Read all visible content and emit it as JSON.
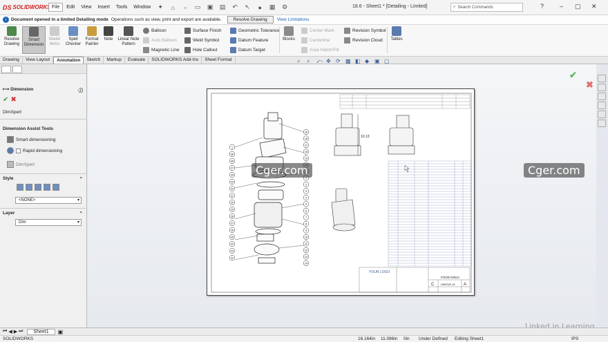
{
  "app": {
    "logo_ds": "DS",
    "logo": "SOLIDWORKS",
    "title": "18.6 - Sheet1 * [Detailing - Limited]"
  },
  "menu": [
    "File",
    "Edit",
    "View",
    "Insert",
    "Tools",
    "Window"
  ],
  "search": {
    "placeholder": "Search Commands"
  },
  "infobar": {
    "bold": "Document opened in a limited Detailing mode",
    "text": "Operations such as view, print and export are available.",
    "button": "Resolve Drawing",
    "link": "View Limitations"
  },
  "ribbon": {
    "resolve": "Resolve Drawing",
    "smart": "Smart Dimension",
    "model": "Model Items",
    "spell": "Spell Checker",
    "painter": "Format Painter",
    "note": "Note",
    "linear": "Linear Note Pattern",
    "balloon": "Balloon",
    "autoballoon": "Auto Balloon",
    "magnetic": "Magnetic Line",
    "surface": "Surface Finish",
    "weld": "Weld Symbol",
    "hole": "Hole Callout",
    "geom": "Geometric Tolerance",
    "datumf": "Datum Feature",
    "datumt": "Datum Target",
    "blocks": "Blocks",
    "center": "Center Mark",
    "centerline": "Centerline",
    "hatch": "Area Hatch/Fill",
    "rev": "Revision Symbol",
    "revcloud": "Revision Cloud",
    "tables": "Tables"
  },
  "tabs": [
    "Drawing",
    "View Layout",
    "Annotation",
    "Sketch",
    "Markup",
    "Evaluate",
    "SOLIDWORKS Add-Ins",
    "Sheet Format"
  ],
  "active_tab": "Annotation",
  "panel": {
    "title": "Dimension",
    "dimxpert": "DimXpert",
    "assist": "Dimension Assist Tools",
    "smart": "Smart dimensioning",
    "rapid": "Rapid dimensioning",
    "dimxpert2": "DimXpert",
    "style": "Style",
    "style_value": "<NONE>",
    "layer": "Layer",
    "layer_value": "Dim"
  },
  "drawing": {
    "dim": "10.13",
    "logo": "YOUR LOGO",
    "product": "FOOD NINJA",
    "size": "C",
    "dwg": "DM2020-41",
    "sheet_rev": "A"
  },
  "balloons_left": [
    "1",
    "36",
    "35",
    "27",
    "34",
    "33",
    "32",
    "31",
    "30",
    "29",
    "28",
    "27",
    "26",
    "25",
    "24",
    "23",
    "22"
  ],
  "balloons_right": [
    "15",
    "16",
    "17",
    "18",
    "19",
    "20",
    "21",
    "1",
    "2",
    "3",
    "4",
    "5",
    "6",
    "7",
    "8",
    "9",
    "10",
    "11",
    "12",
    "13",
    "14"
  ],
  "watermark": "Cger.com",
  "linkedin": "Linked in Learning",
  "sheet_tab": "Sheet1",
  "status": {
    "app": "SOLIDWORKS",
    "x": "16.164in",
    "y": "11.086in",
    "z": "0in",
    "def": "Under Defined",
    "edit": "Editing Sheet1",
    "units": "IPS"
  },
  "colors": {
    "brand": "#d21f1f",
    "accent": "#1a63b8",
    "ok": "#5cb85c"
  }
}
